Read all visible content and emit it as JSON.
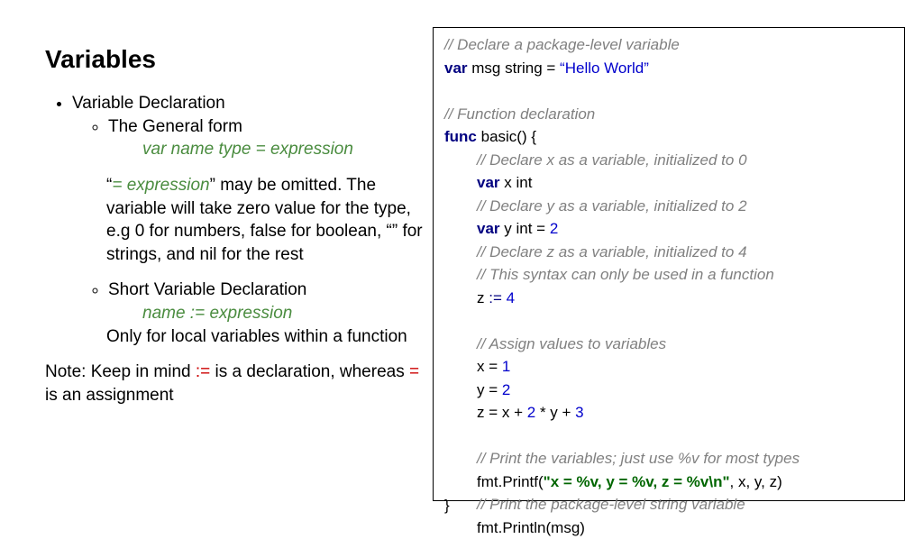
{
  "title": "Variables",
  "bullet1": "Variable Declaration",
  "bullet1a": "The General form",
  "general_form": "var name type = expression",
  "explain1a_quote_open": "“",
  "explain1a_expr": "= expression",
  "explain1a_rest": "” may be omitted. The variable will take zero value for the type, e.g 0 for numbers, false for boolean, “” for strings, and nil for the rest",
  "bullet1b": "Short Variable Declaration",
  "short_form": "name := expression",
  "explain1b": "Only for local variables within a function",
  "note_pre": "Note: Keep in mind ",
  "note_op1": ":=",
  "note_mid": " is a declaration, whereas ",
  "note_op2": "=",
  "note_post": " is an assignment",
  "code": {
    "c1": "// Declare a package-level variable",
    "l2_kw": "var",
    "l2_rest": " msg string = ",
    "l2_str": "“Hello World”",
    "c3": "// Function declaration",
    "l4_kw": "func",
    "l4_rest": " basic() {",
    "c5": "// Declare x as a variable, initialized to 0",
    "l6_kw": "var",
    "l6_rest": " x int",
    "c7": "// Declare y as a variable, initialized to 2",
    "l8_kw": "var",
    "l8_rest": " y int = ",
    "l8_num": "2",
    "c9": "// Declare z as a variable, initialized to 4",
    "c10": "// This syntax can only be used in a function",
    "l11_pre": "z ",
    "l11_op": ":=",
    "l11_sp": " ",
    "l11_num": "4",
    "c12": "// Assign values to variables",
    "l13_pre": "x = ",
    "l13_num": "1",
    "l14_pre": "y = ",
    "l14_num": "2",
    "l15_pre": "z = x + ",
    "l15_num1": "2",
    "l15_mid": " * y + ",
    "l15_num2": "3",
    "c16": "// Print the variables; just use %v for most types",
    "l17_pre": "fmt.Printf(",
    "l17_str": "\"x = %v, y = %v, z = %v\\n\"",
    "l17_post": ", x, y, z)",
    "c18": "// Print the package-level string variable",
    "l19": "fmt.Println(msg)",
    "close": "}"
  }
}
